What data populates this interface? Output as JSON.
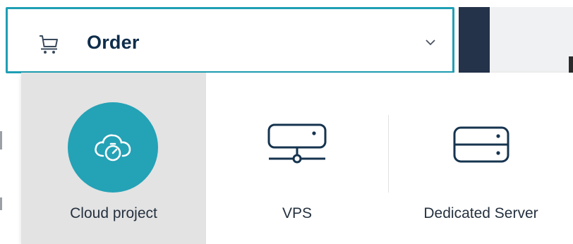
{
  "order": {
    "title": "Order",
    "icon": "cart-icon",
    "chevron": "chevron-down-icon"
  },
  "menu": {
    "items": [
      {
        "label": "Cloud project",
        "icon": "cloud-project-icon",
        "selected": true
      },
      {
        "label": "VPS",
        "icon": "vps-icon",
        "selected": false
      },
      {
        "label": "Dedicated Server",
        "icon": "dedicated-server-icon",
        "selected": false
      }
    ]
  },
  "colors": {
    "accent": "#1f9fb4",
    "navy": "#0e2d4b",
    "dark_strip": "#24324a",
    "selected_bg": "#e3e3e3"
  }
}
